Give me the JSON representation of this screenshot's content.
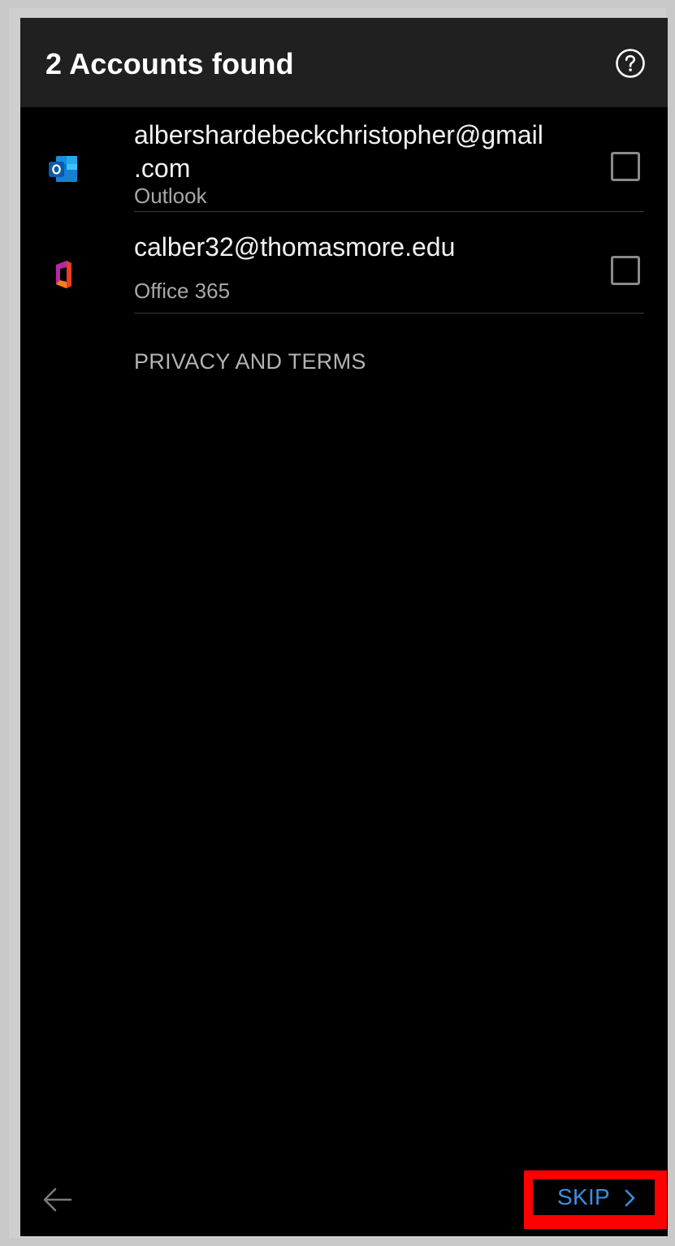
{
  "header": {
    "title": "2 Accounts found",
    "help_icon": "help-circle-icon"
  },
  "accounts": [
    {
      "email": "albershardebeckchristopher@gmail .com",
      "provider": "Outlook",
      "icon": "outlook-icon",
      "checked": false
    },
    {
      "email": "calber32@thomasmore.edu",
      "provider": "Office 365",
      "icon": "office-365-icon",
      "checked": false
    }
  ],
  "links": {
    "privacy": "PRIVACY AND TERMS"
  },
  "footer": {
    "back_icon": "arrow-left-icon",
    "skip_label": "SKIP",
    "skip_icon": "chevron-right-icon"
  },
  "colors": {
    "accent": "#3b8fe0",
    "highlight": "#ff0000",
    "background": "#000000",
    "appbar": "#202020"
  }
}
